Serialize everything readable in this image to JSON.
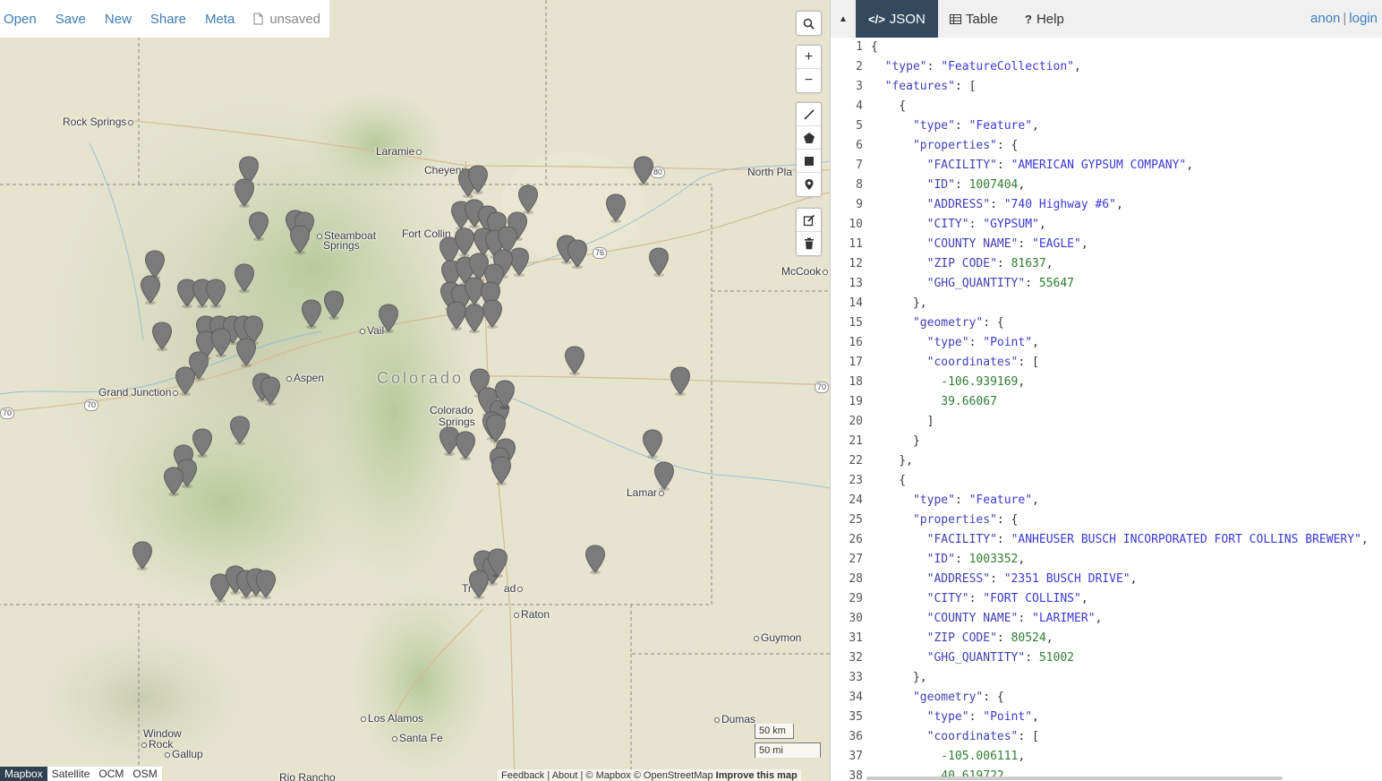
{
  "menu": {
    "open": "Open",
    "save": "Save",
    "new": "New",
    "share": "Share",
    "meta": "Meta",
    "file_state": "unsaved"
  },
  "map_labels": {
    "rock_springs": "Rock Springs",
    "laramie": "Laramie",
    "cheyenne": "Cheyenn",
    "north_platte": "North Pla",
    "steamboat_1": "Steamboat",
    "steamboat_2": "Springs",
    "fort_collins": "Fort Collin",
    "mccook": "McCook",
    "vail": "Vail",
    "aspen": "Aspen",
    "colorado": "Colorado",
    "grand_junction": "Grand Junction",
    "colorado_springs_1": "Colorado",
    "colorado_springs_2": "Springs",
    "lamar": "Lamar",
    "trinidad": "Tr",
    "trinidad_end": "ad",
    "raton": "Raton",
    "guymon": "Guymon",
    "los_alamos": "Los Alamos",
    "dumas": "Dumas",
    "santa_fe": "Santa Fe",
    "window_rock_1": "Window",
    "window_rock_2": "Rock",
    "gallup": "Gallup",
    "rio_rancho": "Rio Rancho",
    "i70_w": "70",
    "i70_gj": "70",
    "i70_e": "70",
    "i76": "76",
    "i80": "80"
  },
  "map_controls": {
    "search": "search-icon",
    "zoom_in": "+",
    "zoom_out": "−"
  },
  "scale": {
    "km": "50 km",
    "mi": "50 mi"
  },
  "layers": [
    "Mapbox",
    "Satellite",
    "OCM",
    "OSM"
  ],
  "attribution": {
    "feedback": "Feedback",
    "about": "About",
    "copyright": "© Mapbox © OpenStreetMap",
    "improve": "Improve this map"
  },
  "pane": {
    "collapse": "▲",
    "tabs": {
      "json": "JSON",
      "table": "Table",
      "help": "Help"
    },
    "user_anon": "anon",
    "user_sep": "|",
    "user_login": "login"
  },
  "code_lines": [
    "{",
    "  \"type\": \"FeatureCollection\",",
    "  \"features\": [",
    "    {",
    "      \"type\": \"Feature\",",
    "      \"properties\": {",
    "        \"FACILITY\": \"AMERICAN GYPSUM COMPANY\",",
    "        \"ID\": 1007404,",
    "        \"ADDRESS\": \"740 Highway #6\",",
    "        \"CITY\": \"GYPSUM\",",
    "        \"COUNTY NAME\": \"EAGLE\",",
    "        \"ZIP CODE\": 81637,",
    "        \"GHG_QUANTITY\": 55647",
    "      },",
    "      \"geometry\": {",
    "        \"type\": \"Point\",",
    "        \"coordinates\": [",
    "          -106.939169,",
    "          39.66067",
    "        ]",
    "      }",
    "    },",
    "    {",
    "      \"type\": \"Feature\",",
    "      \"properties\": {",
    "        \"FACILITY\": \"ANHEUSER BUSCH INCORPORATED FORT COLLINS BREWERY\",",
    "        \"ID\": 1003352,",
    "        \"ADDRESS\": \"2351 BUSCH DRIVE\",",
    "        \"CITY\": \"FORT COLLINS\",",
    "        \"COUNTY NAME\": \"LARIMER\",",
    "        \"ZIP CODE\": 80524,",
    "        \"GHG_QUANTITY\": 51002",
    "      },",
    "      \"geometry\": {",
    "        \"type\": \"Point\",",
    "        \"coordinates\": [",
    "          -105.006111,",
    "          40.619722"
  ],
  "colors": {
    "link": "#3c7cb8",
    "tab_active": "#34495e",
    "json_key": "#3f3fb5",
    "json_number": "#2e7d32",
    "marker": "#7b7b7b"
  }
}
